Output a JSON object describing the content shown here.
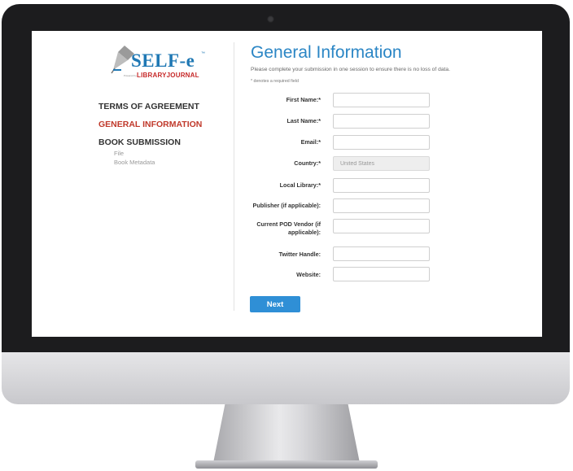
{
  "logo": {
    "main_text": "SELF-e",
    "trademark": "™",
    "powered_by": "Powered by",
    "sub_text": "LIBRARYJOURNAL"
  },
  "nav": {
    "items": [
      {
        "label": "TERMS OF AGREEMENT",
        "active": false
      },
      {
        "label": "GENERAL INFORMATION",
        "active": true
      },
      {
        "label": "BOOK SUBMISSION",
        "active": false
      }
    ],
    "sub_items": [
      {
        "label": "File"
      },
      {
        "label": "Book Metadata"
      }
    ]
  },
  "page": {
    "title": "General Information",
    "intro": "Please complete your submission in one session to ensure there is no loss of data.",
    "required_note": "* denotes a required field"
  },
  "form": {
    "fields": [
      {
        "label": "First Name:*",
        "value": ""
      },
      {
        "label": "Last Name:*",
        "value": ""
      },
      {
        "label": "Email:*",
        "value": ""
      },
      {
        "label": "Country:*",
        "value": "United States",
        "disabled": true
      },
      {
        "label": "Local Library:*",
        "value": ""
      },
      {
        "label": "Publisher (if applicable):",
        "value": ""
      },
      {
        "label": "Current POD Vendor (if applicable):",
        "value": ""
      },
      {
        "label": "Twitter Handle:",
        "value": ""
      },
      {
        "label": "Website:",
        "value": ""
      }
    ],
    "next_label": "Next"
  },
  "colors": {
    "accent": "#2b86c5",
    "button": "#2f8fd6",
    "active_nav": "#c0392b",
    "logo_blue": "#1f78b4",
    "logo_red": "#c62828",
    "bezel": "#1c1c1e"
  }
}
